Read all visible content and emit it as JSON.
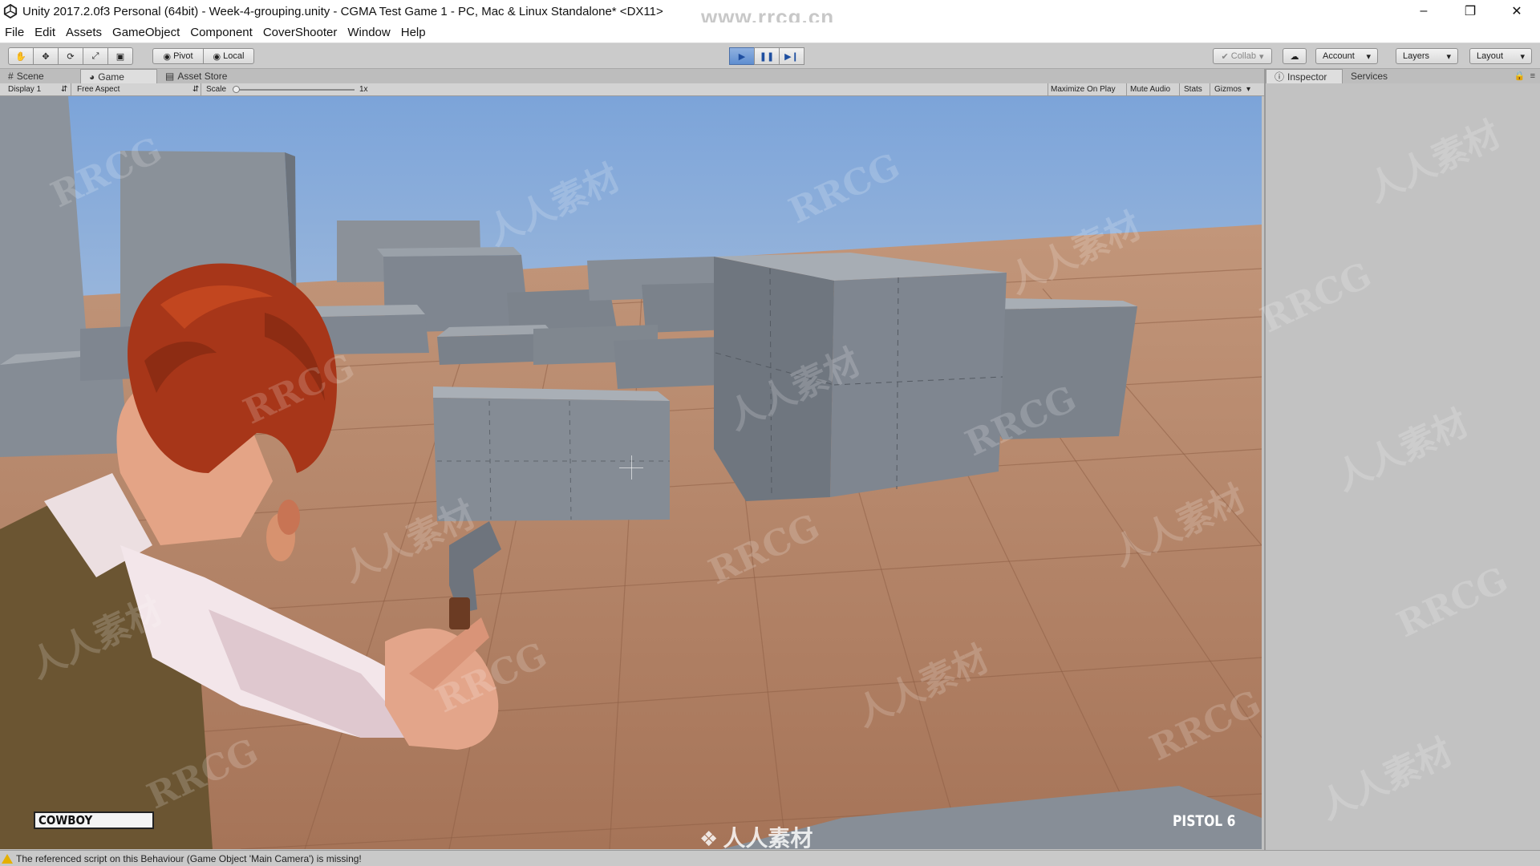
{
  "window": {
    "title": "Unity 2017.2.0f3 Personal (64bit) - Week-4-grouping.unity - CGMA Test Game 1 - PC, Mac & Linux Standalone* <DX11>",
    "watermark": "www.rrcg.cn"
  },
  "menu": [
    "File",
    "Edit",
    "Assets",
    "GameObject",
    "Component",
    "CoverShooter",
    "Window",
    "Help"
  ],
  "toolbar": {
    "pivot_label": "Pivot",
    "local_label": "Local",
    "collab_label": "Collab",
    "account_label": "Account",
    "layers_label": "Layers",
    "layout_label": "Layout"
  },
  "tabs": {
    "scene": "Scene",
    "game": "Game",
    "asset_store": "Asset Store",
    "inspector": "Inspector",
    "services": "Services"
  },
  "game_controls": {
    "display": "Display 1",
    "aspect": "Free Aspect",
    "scale_label": "Scale",
    "scale_value": "1x",
    "maximize": "Maximize On Play",
    "mute": "Mute Audio",
    "stats": "Stats",
    "gizmos": "Gizmos"
  },
  "hud": {
    "character_name": "COWBOY",
    "weapon_label": "PISTOL 6",
    "bottom_logo": "人人素材"
  },
  "status": {
    "message": "The referenced script on this Behaviour (Game Object 'Main Camera') is missing!"
  },
  "colors": {
    "sky_top": "#7fa6d8",
    "sky_bottom": "#d7dde4",
    "ground": "#b48062",
    "box": "#7d848d",
    "hair": "#a9361b"
  }
}
